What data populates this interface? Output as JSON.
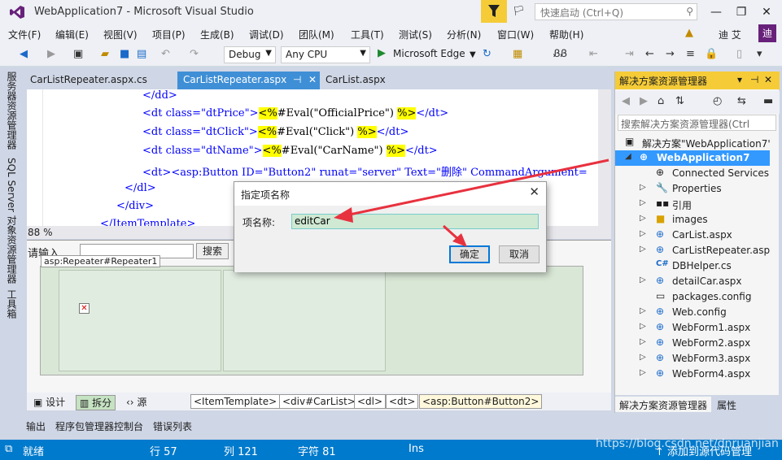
{
  "window": {
    "title": "WebApplication7 - Microsoft Visual Studio",
    "quick_launch_placeholder": "快速启动 (Ctrl+Q)",
    "user_name": "迪 艾",
    "avatar_initial": "迪"
  },
  "menu": [
    "文件(F)",
    "编辑(E)",
    "视图(V)",
    "项目(P)",
    "生成(B)",
    "调试(D)",
    "团队(M)",
    "工具(T)",
    "测试(S)",
    "分析(N)",
    "窗口(W)",
    "帮助(H)"
  ],
  "toolbar": {
    "config": "Debug",
    "platform": "Any CPU",
    "run_target": "Microsoft Edge"
  },
  "left_tabs": [
    "服务器资源管理器",
    "SQL Server 对象资源管理器",
    "工具箱"
  ],
  "doc_tabs": [
    {
      "label": "CarListRepeater.aspx.cs"
    },
    {
      "label": "CarListRepeater.aspx",
      "pin": "⊣",
      "close": "✕"
    },
    {
      "label": "CarList.aspx"
    }
  ],
  "code_lines": [
    {
      "text": "</dd>"
    },
    {
      "pre": "<dt class=\"dtPrice\">",
      "hl1": "<%",
      "mid": "#Eval(\"OfficialPrice\") ",
      "hl2": "%>",
      "post": "</dt>"
    },
    {
      "pre": "<dt class=\"dtClick\">",
      "hl1": "<%",
      "mid": "#Eval(\"Click\") ",
      "hl2": "%>",
      "post": "</dt>"
    },
    {
      "pre": "<dt class=\"dtName\">",
      "hl1": "<%",
      "mid": "#Eval(\"CarName\") ",
      "hl2": "%>",
      "post": "</dt>"
    },
    {
      "text": "<dt><asp:Button ID=\"Button2\" runat=\"server\" Text=\"删除\" CommandArgument="
    },
    {
      "text": "</dl>"
    },
    {
      "text": "</div>"
    },
    {
      "text": "</ItemTemplate>"
    }
  ],
  "editor": {
    "zoom": "88 %"
  },
  "design": {
    "search_label": "请输入",
    "search_button": "搜索",
    "repeater_label": "asp:Repeater#Repeater1"
  },
  "view_buttons": {
    "design": "设计",
    "split": "拆分",
    "source": "源"
  },
  "breadcrumbs": [
    "<ItemTemplate>",
    "<div#CarList>",
    "<dl>",
    "<dt>",
    "<asp:Button#Button2>"
  ],
  "output_tabs": [
    "输出",
    "程序包管理器控制台",
    "错误列表"
  ],
  "status": {
    "ready": "就绪",
    "row": "行 57",
    "col": "列 121",
    "char": "字符 81",
    "mode": "Ins",
    "publish": "↑ 添加到源代码管理"
  },
  "watermark": "https://blog.csdn.net/dnruanjian",
  "solution_explorer": {
    "title": "解决方案资源管理器",
    "search_placeholder": "搜索解决方案资源管理器(Ctrl",
    "solution": "解决方案\"WebApplication7\"",
    "project": "WebApplication7",
    "items": [
      "Connected Services",
      "Properties",
      "引用",
      "images",
      "CarList.aspx",
      "CarListRepeater.aspx",
      "DBHelper.cs",
      "detailCar.aspx",
      "packages.config",
      "Web.config",
      "WebForm1.aspx",
      "WebForm2.aspx",
      "WebForm3.aspx",
      "WebForm4.aspx"
    ],
    "tabs": [
      "解决方案资源管理器",
      "属性"
    ]
  },
  "dialog": {
    "title": "指定项名称",
    "label": "项名称:",
    "value": "editCar",
    "ok": "确定",
    "cancel": "取消"
  },
  "colors": {
    "accent": "#007acc",
    "highlight_yellow": "#ffff00",
    "tab_active": "#3f8fd6",
    "selection": "#3399ff"
  }
}
